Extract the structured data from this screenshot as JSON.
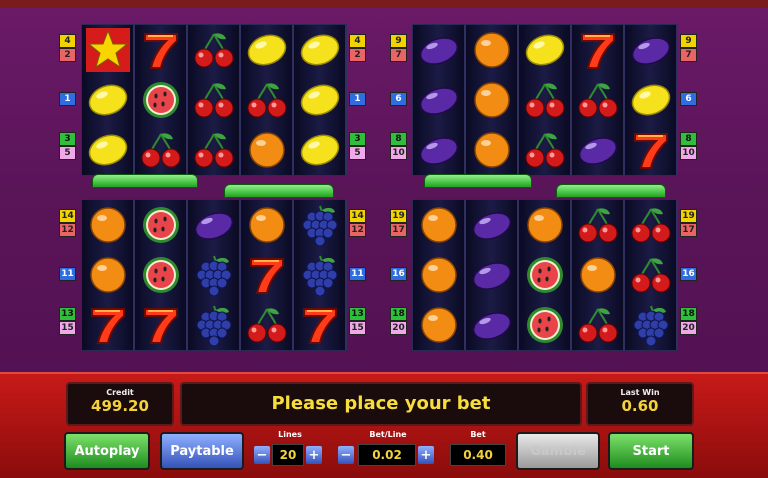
{
  "game": {
    "panels": [
      {
        "name": "top-left",
        "left_lines": [
          [
            "4",
            "2"
          ],
          [
            "1"
          ],
          [
            "3",
            "5"
          ]
        ],
        "right_lines": [
          [
            "4",
            "2"
          ],
          [
            "1"
          ],
          [
            "3",
            "5"
          ]
        ],
        "reels": [
          [
            "star",
            "lemon",
            "lemon"
          ],
          [
            "seven",
            "watermelon",
            "cherry"
          ],
          [
            "cherry",
            "cherry",
            "cherry"
          ],
          [
            "lemon",
            "cherry",
            "orange"
          ],
          [
            "lemon",
            "lemon",
            "lemon"
          ]
        ]
      },
      {
        "name": "top-right",
        "left_lines": [
          [
            "9",
            "7"
          ],
          [
            "6"
          ],
          [
            "8",
            "10"
          ]
        ],
        "right_lines": [
          [
            "9",
            "7"
          ],
          [
            "6"
          ],
          [
            "8",
            "10"
          ]
        ],
        "reels": [
          [
            "plum",
            "plum",
            "plum"
          ],
          [
            "orange",
            "orange",
            "orange"
          ],
          [
            "lemon",
            "cherry",
            "cherry"
          ],
          [
            "seven",
            "cherry",
            "plum"
          ],
          [
            "plum",
            "lemon",
            "seven"
          ]
        ]
      },
      {
        "name": "bottom-left",
        "left_lines": [
          [
            "14",
            "12"
          ],
          [
            "11"
          ],
          [
            "13",
            "15"
          ]
        ],
        "right_lines": [
          [
            "14",
            "12"
          ],
          [
            "11"
          ],
          [
            "13",
            "15"
          ]
        ],
        "reels": [
          [
            "orange",
            "orange",
            "seven"
          ],
          [
            "watermelon",
            "watermelon",
            "seven"
          ],
          [
            "plum",
            "grape",
            "grape"
          ],
          [
            "orange",
            "seven",
            "cherry"
          ],
          [
            "grape",
            "grape",
            "seven"
          ]
        ]
      },
      {
        "name": "bottom-right",
        "left_lines": [
          [
            "19",
            "17"
          ],
          [
            "16"
          ],
          [
            "18",
            "20"
          ]
        ],
        "right_lines": [
          [
            "19",
            "17"
          ],
          [
            "16"
          ],
          [
            "18",
            "20"
          ]
        ],
        "reels": [
          [
            "orange",
            "orange",
            "orange"
          ],
          [
            "plum",
            "plum",
            "plum"
          ],
          [
            "orange",
            "watermelon",
            "watermelon"
          ],
          [
            "cherry",
            "orange",
            "cherry"
          ],
          [
            "cherry",
            "cherry",
            "grape"
          ]
        ]
      }
    ]
  },
  "controls": {
    "credit_label": "Credit",
    "credit_value": "499.20",
    "message": "Please place your bet",
    "last_win_label": "Last Win",
    "last_win_value": "0.60",
    "autoplay_label": "Autoplay",
    "paytable_label": "Paytable",
    "lines_label": "Lines",
    "lines_value": "20",
    "bet_line_label": "Bet/Line",
    "bet_line_value": "0.02",
    "bet_label": "Bet",
    "bet_value": "0.40",
    "gamble_label": "Gamble",
    "start_label": "Start",
    "minus": "−",
    "plus": "+"
  },
  "colors": {
    "background": "#5a1458",
    "bottom_bar": "#b81614",
    "display_text": "#f4d23c"
  }
}
